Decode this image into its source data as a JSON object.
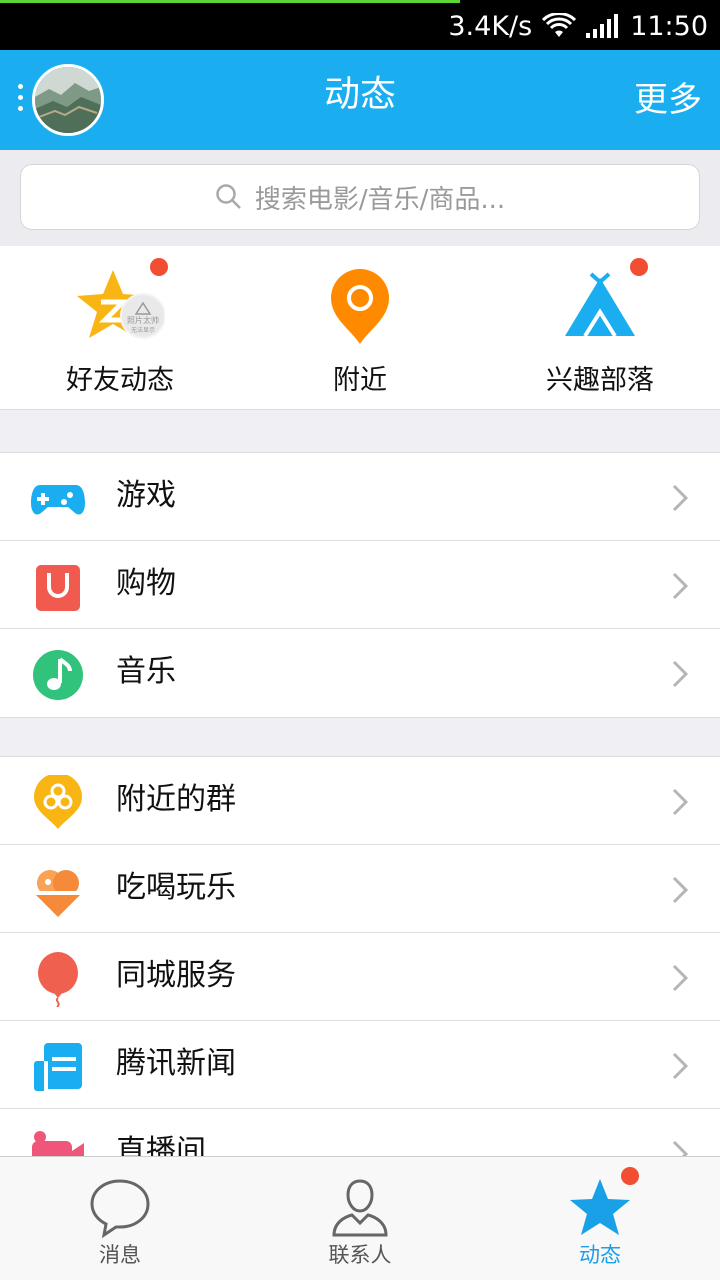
{
  "status_bar": {
    "speed": "3.4K/s",
    "time": "11:50"
  },
  "header": {
    "title": "动态",
    "more_label": "更多"
  },
  "search": {
    "placeholder": "搜索电影/音乐/商品..."
  },
  "quick_links": [
    {
      "label": "好友动态",
      "badge": true,
      "watermark": "照片太帅",
      "watermark_sub": "无法显示"
    },
    {
      "label": "附近",
      "badge": false
    },
    {
      "label": "兴趣部落",
      "badge": true
    }
  ],
  "group1": [
    {
      "label": "游戏",
      "icon": "gamepad-icon"
    },
    {
      "label": "购物",
      "icon": "shopping-bag-icon"
    },
    {
      "label": "音乐",
      "icon": "music-note-icon"
    }
  ],
  "group2": [
    {
      "label": "附近的群",
      "icon": "nearby-group-icon"
    },
    {
      "label": "吃喝玩乐",
      "icon": "ice-cream-icon"
    },
    {
      "label": "同城服务",
      "icon": "balloon-icon"
    },
    {
      "label": "腾讯新闻",
      "icon": "news-icon"
    },
    {
      "label": "直播间",
      "icon": "video-camera-icon"
    }
  ],
  "bottom_tabs": [
    {
      "label": "消息",
      "icon": "chat-bubble-icon",
      "active": false
    },
    {
      "label": "联系人",
      "icon": "contacts-icon",
      "active": false
    },
    {
      "label": "动态",
      "icon": "star-icon",
      "active": true,
      "badge": true
    }
  ],
  "colors": {
    "header": "#1aaef0",
    "badge": "#f24e33",
    "active_tab": "#1aa0e6"
  }
}
